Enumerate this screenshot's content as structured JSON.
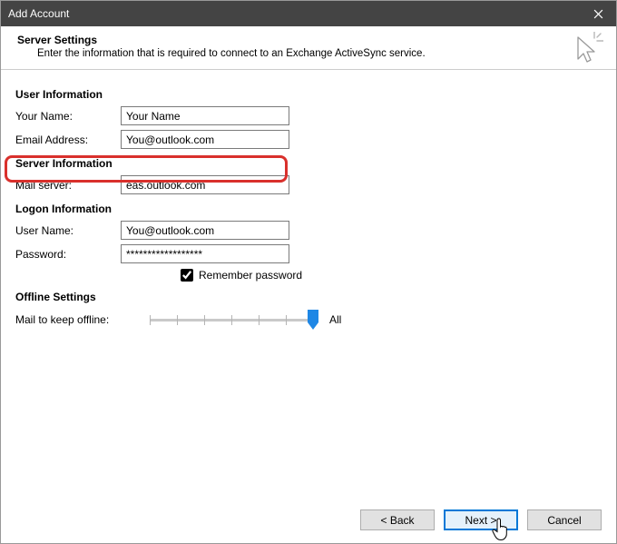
{
  "titlebar": {
    "title": "Add Account"
  },
  "header": {
    "heading": "Server Settings",
    "subheading": "Enter the information that is required to connect to an Exchange ActiveSync service."
  },
  "sections": {
    "user_info": "User Information",
    "server_info": "Server Information",
    "logon_info": "Logon Information",
    "offline": "Offline Settings"
  },
  "labels": {
    "your_name": "Your Name:",
    "email_address": "Email Address:",
    "mail_server": "Mail server:",
    "user_name": "User Name:",
    "password": "Password:",
    "remember_password": "Remember password",
    "mail_to_keep_offline": "Mail to keep offline:",
    "slider_end": "All"
  },
  "values": {
    "your_name": "Your Name",
    "email_address": "You@outlook.com",
    "mail_server": "eas.outlook.com",
    "user_name": "You@outlook.com",
    "password": "******************",
    "remember_password_checked": true
  },
  "buttons": {
    "back": "< Back",
    "next": "Next >",
    "cancel": "Cancel"
  }
}
